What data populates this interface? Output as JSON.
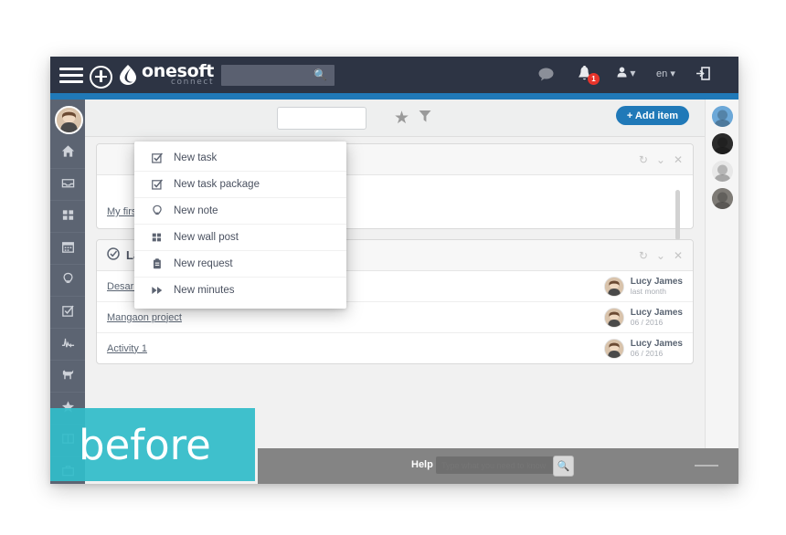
{
  "app": {
    "logo_name": "onesoft",
    "logo_sub": "connect",
    "logo_mark_icon": "droplet-logo-icon"
  },
  "header": {
    "menu_icon": "hamburger-menu-icon",
    "add_icon": "plus-circle-icon",
    "search_placeholder": "",
    "search_value": "",
    "search_icon": "search-icon",
    "chat_icon": "chat-bubble-icon",
    "bell_icon": "bell-icon",
    "bell_badge": "1",
    "user_icon": "user-icon",
    "user_caret": "▾",
    "language": "en",
    "language_caret": "▾",
    "logout_icon": "logout-icon",
    "accent_color": "#2079b8",
    "bar_color": "#2d3444"
  },
  "create_menu": {
    "items": [
      {
        "label": "New task",
        "icon": "checkbox-checked-icon"
      },
      {
        "label": "New task package",
        "icon": "checkbox-checked-icon"
      },
      {
        "label": "New note",
        "icon": "lightbulb-icon"
      },
      {
        "label": "New wall post",
        "icon": "grid-squares-icon"
      },
      {
        "label": "New request",
        "icon": "clipboard-icon"
      },
      {
        "label": "New minutes",
        "icon": "fast-forward-icon"
      }
    ]
  },
  "sidebar": {
    "avatar_icon": "user-avatar",
    "items": [
      {
        "icon": "home-icon",
        "name": "sidebar-item-home"
      },
      {
        "icon": "inbox-icon",
        "name": "sidebar-item-inbox"
      },
      {
        "icon": "grid-icon",
        "name": "sidebar-item-dashboard"
      },
      {
        "icon": "calendar-icon",
        "name": "sidebar-item-calendar"
      },
      {
        "icon": "lightbulb-icon",
        "name": "sidebar-item-notes"
      },
      {
        "icon": "checkbox-icon",
        "name": "sidebar-item-tasks"
      },
      {
        "icon": "chart-icon",
        "name": "sidebar-item-reports"
      },
      {
        "icon": "dog-icon",
        "name": "sidebar-item-pets"
      },
      {
        "icon": "star-icon",
        "name": "sidebar-item-favorites"
      },
      {
        "icon": "book-icon",
        "name": "sidebar-item-library"
      },
      {
        "icon": "briefcase-icon",
        "name": "sidebar-item-projects"
      }
    ]
  },
  "toolbar": {
    "search_value": "",
    "search_placeholder": "",
    "star_icon": "star-icon",
    "filter_icon": "filter-icon",
    "add_item_label": "+ Add item"
  },
  "panels": [
    {
      "title": "",
      "title_icon": "",
      "actions": {
        "refresh": "↻",
        "collapse": "⌄",
        "close": "✕"
      },
      "rows": [
        {
          "link": "My first program"
        }
      ]
    },
    {
      "title": "Last modified",
      "title_icon": "clock-check-icon",
      "actions": {
        "refresh": "↻",
        "collapse": "⌄",
        "close": "✕"
      },
      "rows": [
        {
          "link": "Desarrollo de 30 Placas de Encriptacion",
          "user": "Lucy James",
          "date": "last month"
        },
        {
          "link": "Mangaon project",
          "user": "Lucy James",
          "date": "06 / 2016"
        },
        {
          "link": "Activity 1",
          "user": "Lucy James",
          "date": "06 / 2016"
        }
      ]
    }
  ],
  "right_rail": {
    "avatars": [
      {
        "name": "avatar-green-monster",
        "color": "#6ca8d8"
      },
      {
        "name": "avatar-dark-figure",
        "color": "#2b2b2b"
      },
      {
        "name": "avatar-blue-hat",
        "color": "#e8e8e8"
      },
      {
        "name": "avatar-grey-person",
        "color": "#7e7b76"
      }
    ]
  },
  "help_bar": {
    "label": "Help",
    "placeholder": "Type what you need to know",
    "value": "",
    "search_icon": "search-icon"
  },
  "overlay": {
    "label": "before",
    "color": "#32bcc9"
  }
}
